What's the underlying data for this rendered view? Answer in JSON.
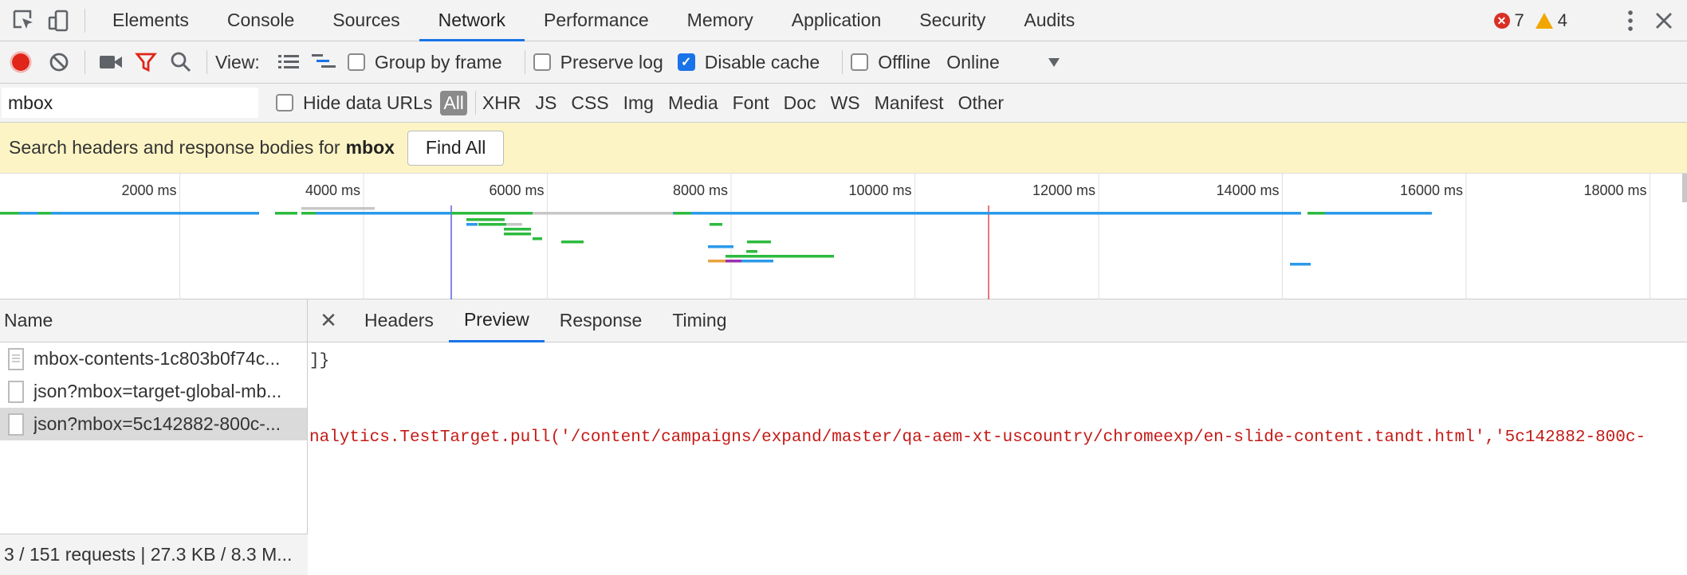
{
  "tabs": [
    "Elements",
    "Console",
    "Sources",
    "Network",
    "Performance",
    "Memory",
    "Application",
    "Security",
    "Audits"
  ],
  "active_tab": "Network",
  "status": {
    "errors": "7",
    "warnings": "4"
  },
  "toolbar": {
    "view_label": "View:",
    "group_by_frame": "Group by frame",
    "preserve_log": "Preserve log",
    "disable_cache": "Disable cache",
    "offline": "Offline",
    "throttle_value": "Online"
  },
  "filter": {
    "value": "mbox",
    "hide_data_urls": "Hide data URLs",
    "types": [
      "All",
      "XHR",
      "JS",
      "CSS",
      "Img",
      "Media",
      "Font",
      "Doc",
      "WS",
      "Manifest",
      "Other"
    ]
  },
  "search_banner": {
    "prefix": "Search headers and response bodies for",
    "term": "mbox",
    "button": "Find All"
  },
  "timeline": {
    "ticks": [
      "2000 ms",
      "4000 ms",
      "6000 ms",
      "8000 ms",
      "10000 ms",
      "12000 ms",
      "14000 ms",
      "16000 ms",
      "18000 ms"
    ],
    "colors": {
      "blue": "#2b9ae9",
      "green": "#2cbb3e",
      "gray": "#c7c7c7",
      "orange": "#e8a33d",
      "purple": "#9b2fae",
      "dom_line": "#5860e0",
      "load_line": "#e04b4b"
    }
  },
  "requests_header": "Name",
  "requests": [
    {
      "name": "mbox-contents-1c803b0f74c...",
      "icon": "document-icon"
    },
    {
      "name": "json?mbox=target-global-mb...",
      "icon": "file-icon"
    },
    {
      "name": "json?mbox=5c142882-800c-...",
      "icon": "file-icon"
    }
  ],
  "selected_request": 2,
  "footer": "3 / 151 requests | 27.3 KB / 8.3 M...",
  "detail_tabs": [
    "Headers",
    "Preview",
    "Response",
    "Timing"
  ],
  "active_detail_tab": "Preview",
  "preview_lines": [
    "]}",
    "nalytics.TestTarget.pull('/content/campaigns/expand/master/qa-aem-xt-uscountry/chromeexp/en-slide-content.tandt.html','5c142882-800c-"
  ]
}
